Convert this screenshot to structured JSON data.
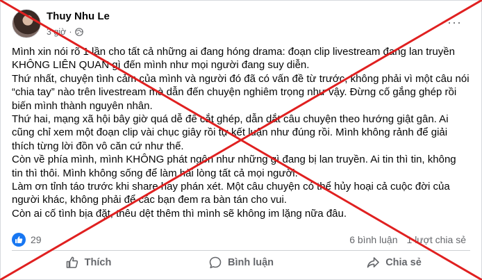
{
  "post": {
    "author": "Thuy Nhu Le",
    "time": "3 giờ",
    "separator": "·",
    "privacy_icon": "globe-icon",
    "more_icon": "more-options-icon",
    "more_label": "···",
    "paragraphs": [
      "Mình xin nói rõ 1 lần cho tất cả những ai đang hóng drama: đoạn clip livestream đang lan truyền",
      "KHÔNG LIÊN QUAN gì đến mình như mọi người đang suy diễn.",
      "Thứ nhất, chuyện tình cảm của mình và người đó đã có vấn đề từ trước, không phải vì một câu nói",
      "“chia tay” nào trên livestream mà dẫn đến chuyện nghiêm trọng như vậy. Đừng cố gắng ghép rồi",
      "biến mình thành nguyên nhân.",
      "Thứ hai, mạng xã hội bây giờ quá dễ để cắt ghép, dẫn dắt câu chuyện theo hướng giật gân. Ai",
      "cũng chỉ xem một đoạn clip vài chục giây rồi tự kết luận như đúng rồi. Mình không rảnh để giải",
      "thích từng lời đồn vô căn cứ như thế.",
      "Còn về phía mình, mình KHÔNG phát ngôn như những gì đang bị lan truyền. Ai tin thì tin, không",
      "tin thì thôi. Mình không sống để làm hài lòng tất cả mọi người.",
      "Làm ơn tỉnh táo trước khi share hay phán xét. Một câu chuyện có thể hủy hoại cả cuộc đời của",
      "người khác, không phải để các bạn đem ra bàn tán cho vui.",
      "Còn ai cố tình bịa đặt, thêu dệt thêm thì mình sẽ không im lặng nữa đâu."
    ]
  },
  "reactions": {
    "icon": "like-icon",
    "count": "29",
    "comments": "6 bình luận",
    "shares": "1 lượt chia sẻ"
  },
  "actions": {
    "like_label": "Thích",
    "comment_label": "Bình luận",
    "share_label": "Chia sẻ"
  },
  "colors": {
    "facebook_blue": "#1877f2",
    "cross_red": "#e02020",
    "secondary_text": "#65676b"
  }
}
